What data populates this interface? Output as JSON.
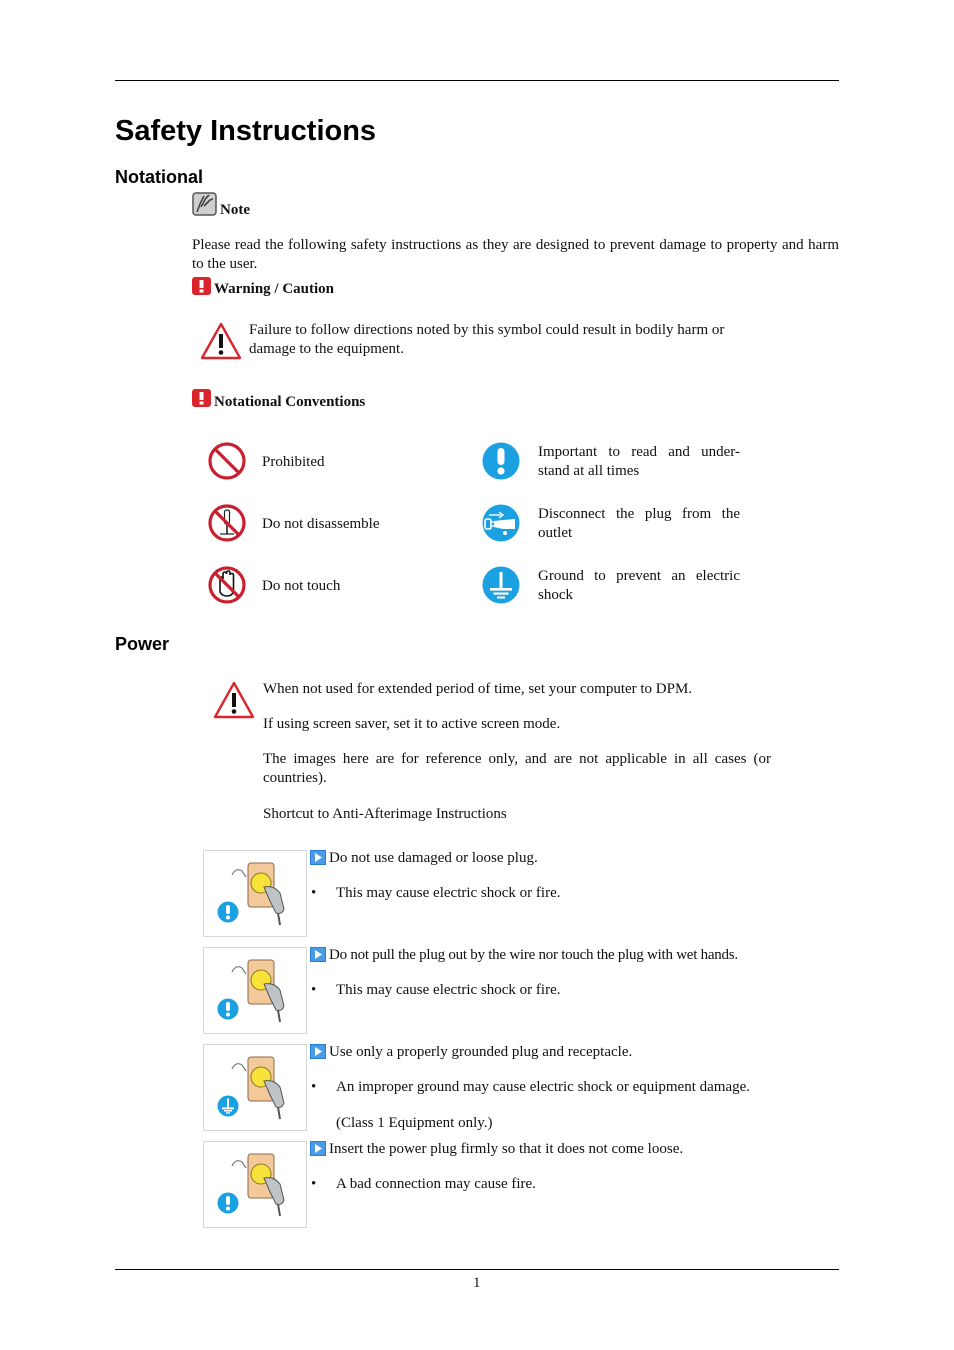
{
  "page": {
    "title": "Safety Instructions",
    "page_number": "1"
  },
  "notational": {
    "heading": "Notational",
    "note_label": "Note",
    "note_text": "Please read the following safety instructions as they are designed to prevent damage to property and harm to the user.",
    "warning_label": "Warning / Caution",
    "warning_text": "Failure to follow directions noted by this symbol could result in bodily harm or damage to the equipment.",
    "conventions_label": "Notational Conventions",
    "conventions": [
      {
        "icon": "prohibited-icon",
        "label": "Prohibited"
      },
      {
        "icon": "important-icon",
        "label": "Important to read and under-stand at all times"
      },
      {
        "icon": "do-not-disassemble-icon",
        "label": "Do not disassemble"
      },
      {
        "icon": "disconnect-plug-icon",
        "label": "Disconnect the plug from the outlet"
      },
      {
        "icon": "do-not-touch-icon",
        "label": "Do not touch"
      },
      {
        "icon": "ground-icon",
        "label": "Ground to prevent an electric shock"
      }
    ]
  },
  "power": {
    "heading": "Power",
    "intro": [
      "When not used for extended period of time, set your computer to DPM.",
      "If using screen saver, set it to active screen mode.",
      "The images here are for reference only, and are not applicable in all cases (or countries).",
      "Shortcut to Anti-Afterimage Instructions"
    ],
    "items": [
      {
        "image_badge": "important-icon",
        "title": "Do not use damaged or loose plug.",
        "bullet": "This may cause electric shock or fire.",
        "extra": ""
      },
      {
        "image_badge": "important-icon",
        "title": "Do not pull the plug out by the wire nor touch the plug with wet hands.",
        "bullet": "This may cause electric shock or fire.",
        "extra": ""
      },
      {
        "image_badge": "ground-icon",
        "title": "Use only a properly grounded plug and receptacle.",
        "bullet": "An improper ground may cause electric shock or equipment damage.",
        "extra": "(Class 1 Equipment only.)"
      },
      {
        "image_badge": "important-icon",
        "title": "Insert the power plug firmly so that it does not come loose.",
        "bullet": "A bad connection may cause fire.",
        "extra": ""
      }
    ]
  },
  "colors": {
    "warning_red": "#d9262c",
    "info_blue": "#1ba1e2",
    "arrow_blue": "#2a7fd4"
  }
}
